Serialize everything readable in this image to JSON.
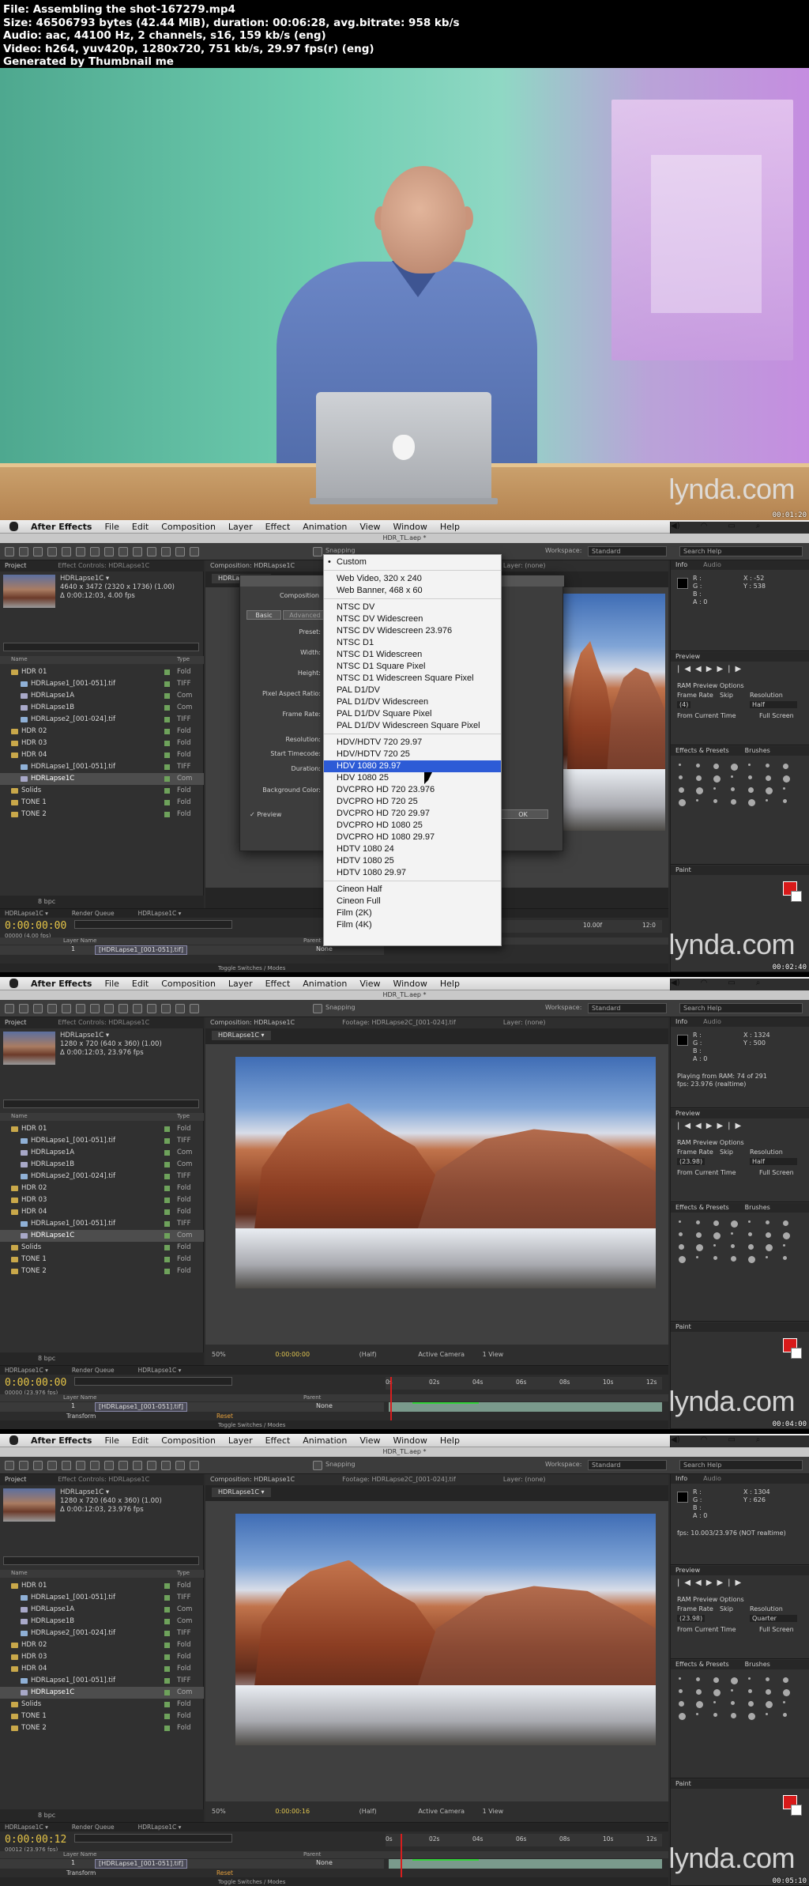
{
  "header": {
    "file": "File: Assembling the shot-167279.mp4",
    "size": "Size: 46506793 bytes (42.44 MiB), duration: 00:06:28, avg.bitrate: 958 kb/s",
    "audio": "Audio: aac, 44100 Hz, 2 channels, s16, 159 kb/s (eng)",
    "video": "Video: h264, yuv420p, 1280x720, 751 kb/s, 29.97 fps(r) (eng)",
    "generator": "Generated by Thumbnail me"
  },
  "watermark": "lynda.com",
  "timestamps": [
    "00:01:20",
    "00:02:40",
    "00:04:00",
    "00:05:10"
  ],
  "menubar": [
    "After Effects",
    "File",
    "Edit",
    "Composition",
    "Layer",
    "Effect",
    "Animation",
    "View",
    "Window",
    "Help"
  ],
  "window_title": "HDR_TL.aep *",
  "toolbar": {
    "snapping": "Snapping",
    "workspace_label": "Workspace:",
    "workspace_value": "Standard",
    "search_placeholder": "Search Help"
  },
  "panels": {
    "project_tab": "Project",
    "effect_controls": "Effect Controls: HDRLapse1C",
    "composition_tab": "Composition: HDRLapse1C",
    "footage_tab": "Footage: HDRLapse2C_[001-024].tif",
    "layer_tab": "Layer: (none)",
    "info_tab": "Info",
    "audio_tab": "Audio",
    "preview_tab": "Preview",
    "ram_options": "RAM Preview Options",
    "frame_rate": "Frame Rate",
    "skip": "Skip",
    "resolution": "Resolution",
    "from_current": "From Current Time",
    "full_screen": "Full Screen",
    "effects_tab": "Effects & Presets",
    "brushes_tab": "Brushes",
    "paint_tab": "Paint",
    "render_queue": "Render Queue",
    "toggle": "Toggle Switches / Modes",
    "layer_name_col": "Layer Name",
    "parent_col": "Parent",
    "none": "None",
    "transform": "Transform",
    "reset": "Reset",
    "bpc": "8 bpc",
    "name_col": "Name",
    "type_col": "Type"
  },
  "project_items": [
    {
      "name": "HDR 01",
      "kind": "folder",
      "type": "Fold"
    },
    {
      "name": "HDRLapse1_[001-051].tif",
      "kind": "file",
      "type": "TIFF"
    },
    {
      "name": "HDRLapse1A",
      "kind": "comp",
      "type": "Com"
    },
    {
      "name": "HDRLapse1B",
      "kind": "comp",
      "type": "Com"
    },
    {
      "name": "HDRLapse2_[001-024].tif",
      "kind": "file",
      "type": "TIFF"
    },
    {
      "name": "HDR 02",
      "kind": "folder",
      "type": "Fold"
    },
    {
      "name": "HDR 03",
      "kind": "folder",
      "type": "Fold"
    },
    {
      "name": "HDR 04",
      "kind": "folder",
      "type": "Fold"
    },
    {
      "name": "HDRLapse1_[001-051].tif",
      "kind": "file",
      "type": "TIFF"
    },
    {
      "name": "HDRLapse1C",
      "kind": "comp",
      "type": "Com"
    },
    {
      "name": "Solids",
      "kind": "folder",
      "type": "Fold"
    },
    {
      "name": "TONE 1",
      "kind": "folder",
      "type": "Fold"
    },
    {
      "name": "TONE 2",
      "kind": "folder",
      "type": "Fold"
    }
  ],
  "screens": [
    {
      "comp_info": [
        "HDRLapse1C ▾",
        "4640 x 3472  (2320 x 1736) (1.00)",
        "Δ 0:00:12:03, 4.00 fps"
      ],
      "timecode": "0:00:00:00",
      "timecode_sub": "00000 (4.00 fps)",
      "layer": "[HDRLapse1_[001-051].tif]",
      "info_xy": [
        "X : -52",
        "Y : 538"
      ],
      "info_rgb": [
        "R :",
        "G :",
        "B :",
        "A : 0"
      ],
      "ram_fps": "(4)",
      "ram_res": "Half",
      "zoom": "12.5%",
      "ticks": [
        "10.00f",
        "12:0"
      ]
    },
    {
      "comp_info": [
        "HDRLapse1C ▾",
        "1280 x 720  (640 x 360) (1.00)",
        "Δ 0:00:12:03, 23.976 fps"
      ],
      "timecode": "0:00:00:00",
      "timecode_sub": "00000 (23.976 fps)",
      "layer": "[HDRLapse1_[001-051].tif]",
      "info_xy": [
        "X : 1324",
        "Y : 500"
      ],
      "info_rgb": [
        "R :",
        "G :",
        "B :",
        "A : 0"
      ],
      "info_msg": "Playing from RAM: 74 of 291\nfps: 23.976 (realtime)",
      "ram_fps": "(23.98)",
      "ram_res": "Half",
      "zoom": "50%",
      "cur_time": "0:00:00:00",
      "view_res": "(Half)",
      "camera": "Active Camera",
      "views": "1 View",
      "ticks": [
        "0s",
        "02s",
        "04s",
        "06s",
        "08s",
        "10s",
        "12s"
      ]
    },
    {
      "comp_info": [
        "HDRLapse1C ▾",
        "1280 x 720  (640 x 360) (1.00)",
        "Δ 0:00:12:03, 23.976 fps"
      ],
      "timecode": "0:00:00:12",
      "timecode_sub": "00012 (23.976 fps)",
      "layer": "[HDRLapse1_[001-051].tif]",
      "info_xy": [
        "X : 1304",
        "Y : 626"
      ],
      "info_rgb": [
        "R :",
        "G :",
        "B :",
        "A : 0"
      ],
      "info_msg": "fps: 10.003/23.976 (NOT realtime)",
      "ram_fps": "(23.98)",
      "ram_res": "Quarter",
      "zoom": "50%",
      "cur_time": "0:00:00:16",
      "view_res": "(Half)",
      "camera": "Active Camera",
      "views": "1 View",
      "ticks": [
        "0s",
        "02s",
        "04s",
        "06s",
        "08s",
        "10s",
        "12s"
      ]
    }
  ],
  "dialog": {
    "title": "Composition",
    "tabs": [
      "Basic",
      "Advanced"
    ],
    "labels": [
      "Preset:",
      "Width:",
      "Height:",
      "Pixel Aspect Ratio:",
      "Frame Rate:",
      "Resolution:",
      "Start Timecode:",
      "Duration:",
      "Background Color:"
    ],
    "preview": "Preview",
    "ok": "OK"
  },
  "preset_menu": {
    "groups": [
      [
        "Custom"
      ],
      [
        "Web Video, 320 x 240",
        "Web Banner, 468 x 60"
      ],
      [
        "NTSC DV",
        "NTSC DV Widescreen",
        "NTSC DV Widescreen 23.976",
        "NTSC D1",
        "NTSC D1 Widescreen",
        "NTSC D1 Square Pixel",
        "NTSC D1 Widescreen Square Pixel",
        "PAL D1/DV",
        "PAL D1/DV Widescreen",
        "PAL D1/DV Square Pixel",
        "PAL D1/DV Widescreen Square Pixel"
      ],
      [
        "HDV/HDTV 720 29.97",
        "HDV/HDTV 720 25",
        "HDV 1080 29.97",
        "HDV 1080 25",
        "DVCPRO HD 720 23.976",
        "DVCPRO HD 720 25",
        "DVCPRO HD 720 29.97",
        "DVCPRO HD 1080 25",
        "DVCPRO HD 1080 29.97",
        "HDTV 1080 24",
        "HDTV 1080 25",
        "HDTV 1080 29.97"
      ],
      [
        "Cineon Half",
        "Cineon Full",
        "Film (2K)",
        "Film (4K)"
      ]
    ],
    "selected": "HDV 1080 29.97",
    "checked": "Custom"
  },
  "colors": {
    "accent_timecode": "#e6c547",
    "menu_highlight": "#2d5bd6",
    "paint_fg": "#d81a1a",
    "playhead": "#d71e1e"
  }
}
